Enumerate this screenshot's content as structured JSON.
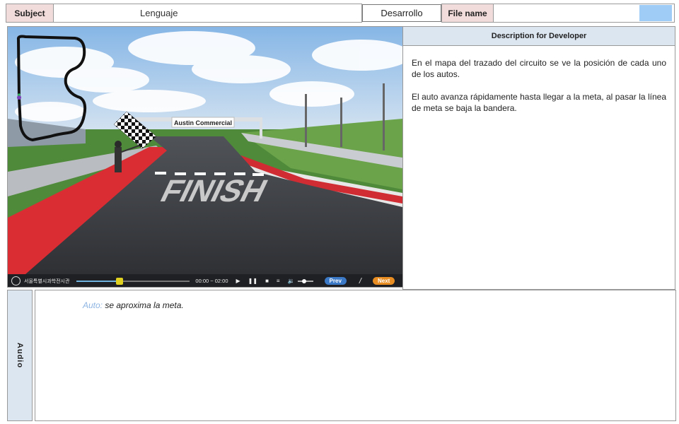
{
  "header": {
    "subject_label": "Subject",
    "subject_value": "Lenguaje",
    "stage_value": "Desarrollo",
    "filename_label": "File name",
    "filename_value": ""
  },
  "scene": {
    "sign_text": "Austin Commercial",
    "road_text": "FINISH",
    "icons": [
      "circuit-map",
      "car-marker",
      "checkered-flag",
      "flag-marshal"
    ]
  },
  "player": {
    "org_name": "서울특별시과학전시관",
    "time": "00:00 ~ 02:00",
    "progress": 0.38,
    "volume": 0.45,
    "prev_label": "Prev",
    "separator": "/",
    "next_label": "Next",
    "icons": [
      "play-icon",
      "pause-icon",
      "stop-icon",
      "menu-icon",
      "volume-icon"
    ]
  },
  "description": {
    "title": "Description for Developer",
    "paragraphs": [
      "En el  mapa del trazado del circuito se ve la posición de cada uno de los autos.",
      "El auto avanza rápidamente hasta llegar a la meta, al pasar la línea de meta se baja la bandera."
    ]
  },
  "audio": {
    "label": "Audio",
    "speaker": "Auto:",
    "line": " se aproxima la meta."
  },
  "colors": {
    "header_label_bg": "#f2dcdb",
    "panel_header_bg": "#dce6f1",
    "swatch": "#9fcbf7",
    "speaker": "#8db4e2",
    "prev_button": "#3b78c5",
    "next_button": "#e78d22"
  }
}
